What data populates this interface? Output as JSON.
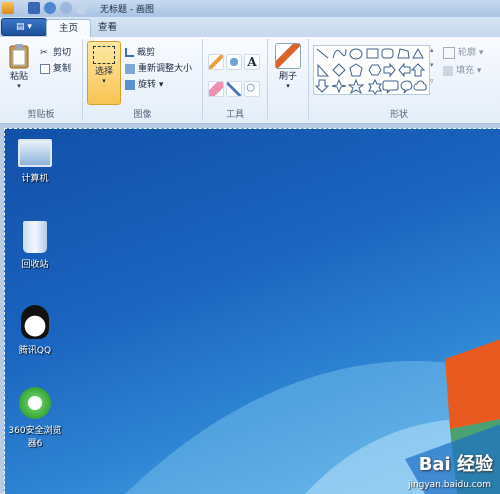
{
  "window": {
    "title": "无标题 - 画图"
  },
  "tabs": [
    {
      "label": "主页"
    },
    {
      "label": "查看"
    }
  ],
  "ribbon": {
    "clipboard": {
      "paste": "粘贴",
      "cut": "剪切",
      "copy": "复制",
      "label": "剪贴板"
    },
    "image": {
      "select": "选择",
      "crop": "裁剪",
      "resize": "重新调整大小",
      "rotate": "旋转",
      "label": "图像"
    },
    "tools": {
      "label": "工具"
    },
    "brushes": {
      "label": "刷子"
    },
    "shapes": {
      "label": "形状",
      "outline": "轮廓",
      "fill": "填充"
    }
  },
  "desktop": {
    "icons": [
      {
        "label": "计算机"
      },
      {
        "label": "回收站"
      },
      {
        "label": "腾讯QQ"
      },
      {
        "label": "360安全浏览器6"
      }
    ]
  },
  "watermark": {
    "main": "Bai 经验",
    "sub": "jingyan.baidu.com"
  }
}
